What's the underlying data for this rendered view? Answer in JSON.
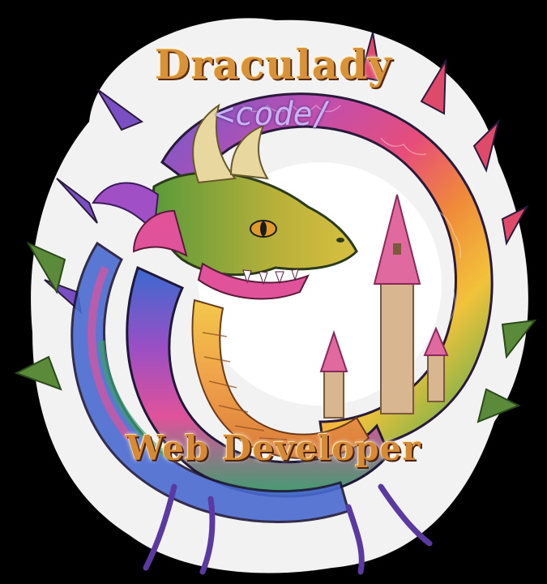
{
  "logo": {
    "title": "Draculady",
    "code_tag": "<code/",
    "subtitle": "Web Developer"
  },
  "colors": {
    "background": "#000000",
    "title_gold": "#d7923a",
    "code_lavender": "#c9b3f2",
    "dragon_pink": "#e0529a",
    "dragon_purple": "#7a4fc4",
    "dragon_green": "#5a8a3a",
    "dragon_gold": "#e9b23a",
    "castle_pink": "#e06aa0"
  },
  "icons": [
    "dragon-illustration",
    "castle-icon"
  ]
}
